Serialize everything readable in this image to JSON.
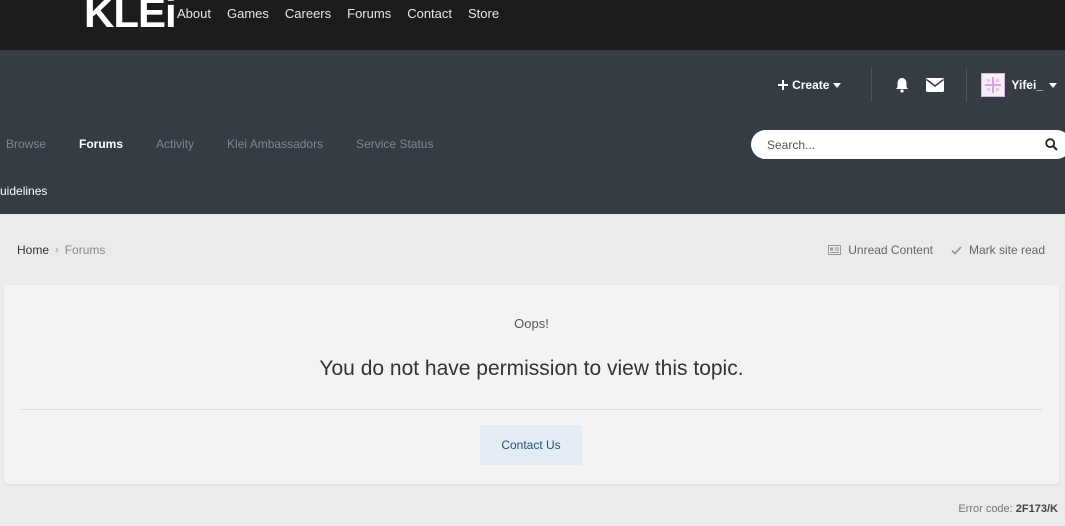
{
  "brand": {
    "logo_text": "KLEi"
  },
  "top_nav": [
    "About",
    "Games",
    "Careers",
    "Forums",
    "Contact",
    "Store"
  ],
  "userbar": {
    "create_label": "Create",
    "username": "Yifei_"
  },
  "main_nav": [
    {
      "label": "Browse",
      "active": false
    },
    {
      "label": "Forums",
      "active": true
    },
    {
      "label": "Activity",
      "active": false
    },
    {
      "label": "Klei Ambassadors",
      "active": false
    },
    {
      "label": "Service Status",
      "active": false
    }
  ],
  "sub_nav": {
    "label": "uidelines"
  },
  "search": {
    "placeholder": "Search..."
  },
  "breadcrumb": {
    "home": "Home",
    "current": "Forums"
  },
  "crumb_actions": {
    "unread": "Unread Content",
    "mark_read": "Mark site read"
  },
  "message": {
    "heading": "Oops!",
    "text": "You do not have permission to view this topic.",
    "button": "Contact Us"
  },
  "error": {
    "label": "Error code:",
    "code": "2F173/K"
  },
  "colors": {
    "top_bar": "#1c1c1c",
    "header": "#353c44",
    "page_bg": "#ebebeb",
    "button_bg": "#e3ecf5"
  }
}
